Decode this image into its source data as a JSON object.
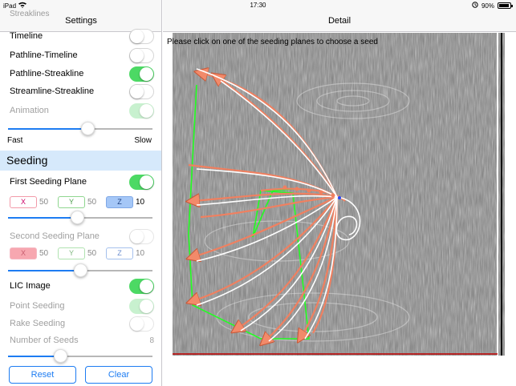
{
  "status_bar": {
    "device": "iPad",
    "time": "17:30",
    "battery": "90%"
  },
  "sidebar": {
    "title": "Settings",
    "ghost_text": "Streaklines",
    "rows": [
      {
        "label": "Timeline",
        "state": "off"
      },
      {
        "label": "Pathline-Timeline",
        "state": "off"
      },
      {
        "label": "Pathline-Streakline",
        "state": "on"
      },
      {
        "label": "Streamline-Streakline",
        "state": "off"
      },
      {
        "label": "Animation",
        "state": "on-disabled"
      }
    ],
    "speed": {
      "min_label": "Fast",
      "max_label": "Slow",
      "value": 0.56
    },
    "section_title": "Seeding",
    "first_plane": {
      "label": "First Seeding Plane",
      "state": "on",
      "x_label": "X",
      "x": "50",
      "y_label": "Y",
      "y": "50",
      "z_label": "Z",
      "z": "10",
      "active_axis": "Z",
      "slider": 0.48
    },
    "second_plane": {
      "label": "Second Seeding Plane",
      "state": "off",
      "x_label": "X",
      "x": "50",
      "y_label": "Y",
      "y": "50",
      "z_label": "Z",
      "z": "10",
      "active_axis": "X",
      "slider": 0.5
    },
    "lic": {
      "label": "LIC Image",
      "state": "on"
    },
    "point_seeding": {
      "label": "Point Seeding",
      "state": "on-disabled"
    },
    "rake_seeding": {
      "label": "Rake Seeding",
      "state": "off"
    },
    "num_seeds": {
      "label": "Number of Seeds",
      "value": "8",
      "slider": 0.35
    },
    "reset_label": "Reset",
    "clear_label": "Clear"
  },
  "detail": {
    "title": "Detail",
    "instruction": "Please click on one of the seeding planes to choose a seed"
  },
  "colors": {
    "accent": "#1d7cf2",
    "toggle_on": "#4cd964",
    "section_bg": "#d6e9fb",
    "seed_plane_green": "#22ff22",
    "pathline_orange": "#f08060",
    "streakline_white": "#ffffff"
  }
}
